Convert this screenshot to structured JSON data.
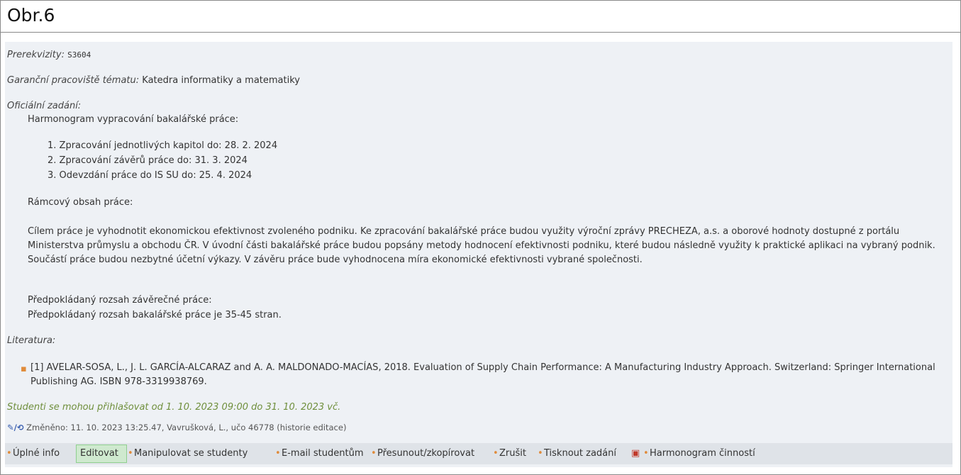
{
  "header": {
    "title": "Obr.6"
  },
  "detail": {
    "prereq_label": "Prerekvizity:",
    "prereq_value": "S3604",
    "guarantor_label": "Garanční pracoviště tématu:",
    "guarantor_value": "Katedra informatiky a matematiky",
    "assignment_label": "Oficiální zadání:",
    "schedule_heading": "Harmonogram vypracování bakalářské práce:",
    "schedule_items": [
      "1. Zpracování jednotlivých kapitol do: 28. 2. 2024",
      "2. Zpracování závěrů práce do: 31. 3. 2024",
      "3. Odevzdání práce do IS SU do: 25. 4. 2024"
    ],
    "content_heading": "Rámcový obsah práce:",
    "content_text": "Cílem práce je vyhodnotit ekonomickou efektivnost zvoleného podniku. Ke zpracování bakalářské práce budou využity výroční zprávy PRECHEZA, a.s. a oborové hodnoty dostupné z portálu Ministerstva průmyslu a obchodu ČR. V úvodní části bakalářské práce budou popsány metody hodnocení efektivnosti podniku, které budou následně využity k praktické aplikaci na vybraný podnik. Součástí práce budou nezbytné účetní výkazy. V závěru práce bude vyhodnocena míra ekonomické efektivnosti vybrané společnosti.",
    "scope_heading": "Předpokládaný rozsah závěrečné práce:",
    "scope_text": "Předpokládaný rozsah bakalářské práce je 35-45 stran.",
    "literature_label": "Literatura:",
    "literature_item": "[1] AVELAR-SOSA, L., J. L. GARCÍA-ALCARAZ and A. A. MALDONADO-MACÍAS, 2018. Evaluation of Supply Chain Performance: A Manufacturing Industry Approach. Switzerland: Springer International Publishing AG. ISBN 978-3319938769.",
    "signup_text": "Studenti se mohou přihlašovat od 1. 10. 2023 09:00 do 31. 10. 2023 vč.",
    "changed_icon": "edit-history-icon",
    "changed_text": "Změněno: 11. 10. 2023 13:25.47, Vavrušková, L., učo 46778 (historie editace)"
  },
  "actions": {
    "full_info": "Úplné info",
    "edit": "Editovat",
    "manage_students": "Manipulovat se studenty",
    "email_students": "E-mail studentům",
    "move_copy": "Přesunout/zkopírovat",
    "cancel": "Zrušit",
    "print": "Tisknout zadání",
    "print_icon": "print-icon",
    "schedule": "Harmonogram činností",
    "separator": "•"
  },
  "colors": {
    "bullet": "#e08b3a",
    "signup": "#6f8f3c",
    "panel": "#eef1f5",
    "highlight": "#cfe9cf"
  }
}
